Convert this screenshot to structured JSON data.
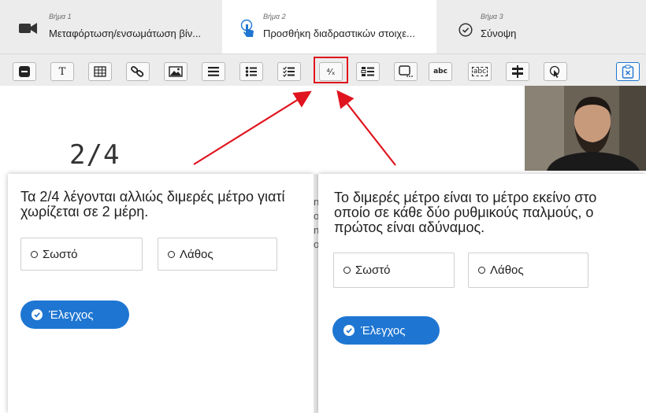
{
  "steps": [
    {
      "small": "Βήμα 1",
      "title": "Μεταφόρτωση/ενσωμάτωση βίν...",
      "icon": "video-camera-icon"
    },
    {
      "small": "Βήμα 2",
      "title": "Προσθήκη διαδραστικών στοιχε...",
      "icon": "touch-pointer-icon"
    },
    {
      "small": "Βήμα 3",
      "title": "Σύνοψη",
      "icon": "check-circle-icon"
    }
  ],
  "toolbar": {
    "text_tool": "T",
    "fraction_tool": "⁴⁄ₓ",
    "fill_blanks": "abc",
    "drag_text": "abc"
  },
  "canvas": {
    "big_text": "2/4"
  },
  "left_card": {
    "question": "Τα 2/4 λέγονται αλλιώς διμερές μέτρο γιατί χωρίζεται σε 2 μέρη.",
    "true_label": "Σωστό",
    "false_label": "Λάθος",
    "check_label": "Έλεγχος"
  },
  "right_card": {
    "question": "Το διμερές μέτρο είναι το μέτρο εκείνο στο οποίο σε κάθε δύο ρυθμικούς παλμούς, ο πρώτος είναι αδύναμος.",
    "true_label": "Σωστό",
    "false_label": "Λάθος",
    "check_label": "Έλεγχος"
  },
  "colors": {
    "accent": "#1f76d2",
    "highlight": "#e0141e"
  }
}
